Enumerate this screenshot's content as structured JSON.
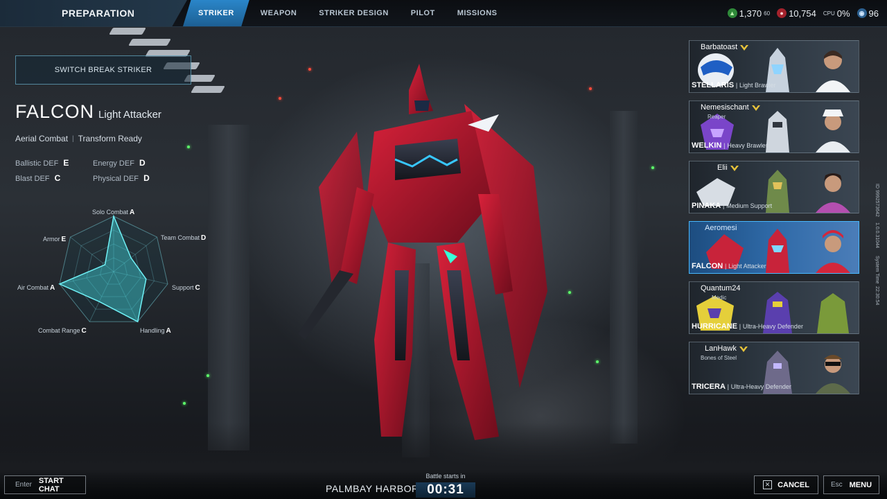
{
  "header": {
    "section_title": "PREPARATION",
    "tabs": [
      {
        "label": "STRIKER",
        "active": true
      },
      {
        "label": "WEAPON",
        "active": false
      },
      {
        "label": "STRIKER DESIGN",
        "active": false
      },
      {
        "label": "PILOT",
        "active": false
      },
      {
        "label": "MISSIONS",
        "active": false
      }
    ],
    "resources": {
      "currency_a": "1,370",
      "fps_label": "60",
      "currency_b": "10,754",
      "cpu_label": "CPU",
      "cpu_value": "0%",
      "ping": "96"
    }
  },
  "left_panel": {
    "switch_button": "SWITCH BREAK STRIKER",
    "striker_name": "FALCON",
    "striker_class": "Light Attacker",
    "traits": [
      "Aerial Combat",
      "Transform Ready"
    ],
    "defenses": [
      {
        "label": "Ballistic DEF",
        "grade": "E"
      },
      {
        "label": "Energy DEF",
        "grade": "D"
      },
      {
        "label": "Blast DEF",
        "grade": "C"
      },
      {
        "label": "Physical DEF",
        "grade": "D"
      }
    ]
  },
  "radar": {
    "axes": [
      {
        "label": "Solo Combat",
        "grade": "A"
      },
      {
        "label": "Team Combat",
        "grade": "D"
      },
      {
        "label": "Support",
        "grade": "C"
      },
      {
        "label": "Handling",
        "grade": "A"
      },
      {
        "label": "Combat Range",
        "grade": "C"
      },
      {
        "label": "Air Combat",
        "grade": "A"
      },
      {
        "label": "Armor",
        "grade": "E"
      }
    ],
    "fill_color": "#3fd0d8"
  },
  "roster": [
    {
      "player": "Barbatoast",
      "title": "",
      "mech": "STELLARIS",
      "mech_class": "Light Brawler",
      "has_rank": true,
      "active": false
    },
    {
      "player": "Nemesischant",
      "title": "Reaper",
      "mech": "WELKIN",
      "mech_class": "Heavy Brawler",
      "has_rank": true,
      "active": false
    },
    {
      "player": "Elii",
      "title": "",
      "mech": "PINAKA",
      "mech_class": "Medium Support",
      "has_rank": true,
      "active": false
    },
    {
      "player": "Aeromesi",
      "title": "",
      "mech": "FALCON",
      "mech_class": "Light Attacker",
      "has_rank": false,
      "active": true
    },
    {
      "player": "Quantum24",
      "title": "Medic",
      "mech": "HURRICANE",
      "mech_class": "Ultra-Heavy Defender",
      "has_rank": false,
      "active": false
    },
    {
      "player": "LanHawk",
      "title": "Bones of Steel",
      "mech": "TRICERA",
      "mech_class": "Ultra-Heavy Defender",
      "has_rank": true,
      "active": false
    }
  ],
  "system_info": {
    "id_text": "ID 9992573642",
    "version": "1.0.0.31044",
    "time_label": "System Time",
    "time": "22:30:54"
  },
  "footer": {
    "chat_key": "Enter",
    "chat_label": "START CHAT",
    "map_name": "PALMBAY HARBOR",
    "battle_caption": "Battle starts in",
    "countdown": "00:31",
    "cancel_label": "CANCEL",
    "menu_key": "Esc",
    "menu_label": "MENU"
  },
  "colors": {
    "accent_blue": "#2a86c9",
    "active_card": "#2f6aa8",
    "rank_gold": "#e8c33a",
    "radar_cyan": "#3fd0d8"
  }
}
